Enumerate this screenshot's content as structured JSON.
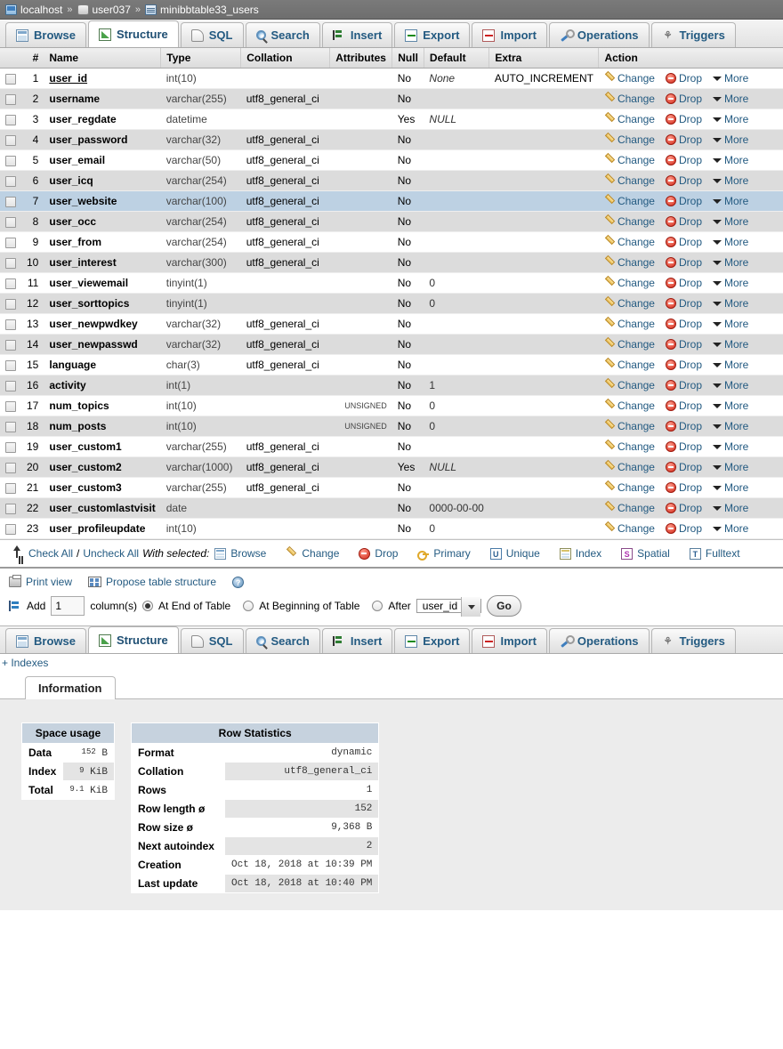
{
  "breadcrumb": {
    "server": "localhost",
    "database": "user037",
    "table": "minibbtable33_users",
    "separator": "»"
  },
  "tabs": [
    {
      "label": "Browse",
      "icon": "browse-icon",
      "active": false
    },
    {
      "label": "Structure",
      "icon": "structure-icon",
      "active": true
    },
    {
      "label": "SQL",
      "icon": "sql-icon",
      "active": false
    },
    {
      "label": "Search",
      "icon": "search-icon",
      "active": false
    },
    {
      "label": "Insert",
      "icon": "insert-icon",
      "active": false
    },
    {
      "label": "Export",
      "icon": "export-icon",
      "active": false
    },
    {
      "label": "Import",
      "icon": "import-icon",
      "active": false
    },
    {
      "label": "Operations",
      "icon": "operations-icon",
      "active": false
    },
    {
      "label": "Triggers",
      "icon": "triggers-icon",
      "active": false
    }
  ],
  "structure": {
    "headers": [
      "#",
      "Name",
      "Type",
      "Collation",
      "Attributes",
      "Null",
      "Default",
      "Extra",
      "Action"
    ],
    "actions": {
      "change": "Change",
      "drop": "Drop",
      "more": "More"
    },
    "rows": [
      {
        "num": 1,
        "name": "user_id",
        "primary": true,
        "type": "int(10)",
        "collation": "",
        "attributes": "",
        "null": "No",
        "default": "None",
        "default_italic": true,
        "extra": "AUTO_INCREMENT",
        "marked": false
      },
      {
        "num": 2,
        "name": "username",
        "primary": false,
        "type": "varchar(255)",
        "collation": "utf8_general_ci",
        "attributes": "",
        "null": "No",
        "default": "",
        "default_italic": false,
        "extra": "",
        "marked": false
      },
      {
        "num": 3,
        "name": "user_regdate",
        "primary": false,
        "type": "datetime",
        "collation": "",
        "attributes": "",
        "null": "Yes",
        "default": "NULL",
        "default_italic": true,
        "extra": "",
        "marked": false
      },
      {
        "num": 4,
        "name": "user_password",
        "primary": false,
        "type": "varchar(32)",
        "collation": "utf8_general_ci",
        "attributes": "",
        "null": "No",
        "default": "",
        "default_italic": false,
        "extra": "",
        "marked": false
      },
      {
        "num": 5,
        "name": "user_email",
        "primary": false,
        "type": "varchar(50)",
        "collation": "utf8_general_ci",
        "attributes": "",
        "null": "No",
        "default": "",
        "default_italic": false,
        "extra": "",
        "marked": false
      },
      {
        "num": 6,
        "name": "user_icq",
        "primary": false,
        "type": "varchar(254)",
        "collation": "utf8_general_ci",
        "attributes": "",
        "null": "No",
        "default": "",
        "default_italic": false,
        "extra": "",
        "marked": false
      },
      {
        "num": 7,
        "name": "user_website",
        "primary": false,
        "type": "varchar(100)",
        "collation": "utf8_general_ci",
        "attributes": "",
        "null": "No",
        "default": "",
        "default_italic": false,
        "extra": "",
        "marked": true
      },
      {
        "num": 8,
        "name": "user_occ",
        "primary": false,
        "type": "varchar(254)",
        "collation": "utf8_general_ci",
        "attributes": "",
        "null": "No",
        "default": "",
        "default_italic": false,
        "extra": "",
        "marked": false
      },
      {
        "num": 9,
        "name": "user_from",
        "primary": false,
        "type": "varchar(254)",
        "collation": "utf8_general_ci",
        "attributes": "",
        "null": "No",
        "default": "",
        "default_italic": false,
        "extra": "",
        "marked": false
      },
      {
        "num": 10,
        "name": "user_interest",
        "primary": false,
        "type": "varchar(300)",
        "collation": "utf8_general_ci",
        "attributes": "",
        "null": "No",
        "default": "",
        "default_italic": false,
        "extra": "",
        "marked": false
      },
      {
        "num": 11,
        "name": "user_viewemail",
        "primary": false,
        "type": "tinyint(1)",
        "collation": "",
        "attributes": "",
        "null": "No",
        "default": "0",
        "default_italic": false,
        "extra": "",
        "marked": false
      },
      {
        "num": 12,
        "name": "user_sorttopics",
        "primary": false,
        "type": "tinyint(1)",
        "collation": "",
        "attributes": "",
        "null": "No",
        "default": "0",
        "default_italic": false,
        "extra": "",
        "marked": false
      },
      {
        "num": 13,
        "name": "user_newpwdkey",
        "primary": false,
        "type": "varchar(32)",
        "collation": "utf8_general_ci",
        "attributes": "",
        "null": "No",
        "default": "",
        "default_italic": false,
        "extra": "",
        "marked": false
      },
      {
        "num": 14,
        "name": "user_newpasswd",
        "primary": false,
        "type": "varchar(32)",
        "collation": "utf8_general_ci",
        "attributes": "",
        "null": "No",
        "default": "",
        "default_italic": false,
        "extra": "",
        "marked": false
      },
      {
        "num": 15,
        "name": "language",
        "primary": false,
        "type": "char(3)",
        "collation": "utf8_general_ci",
        "attributes": "",
        "null": "No",
        "default": "",
        "default_italic": false,
        "extra": "",
        "marked": false
      },
      {
        "num": 16,
        "name": "activity",
        "primary": false,
        "type": "int(1)",
        "collation": "",
        "attributes": "",
        "null": "No",
        "default": "1",
        "default_italic": false,
        "extra": "",
        "marked": false
      },
      {
        "num": 17,
        "name": "num_topics",
        "primary": false,
        "type": "int(10)",
        "collation": "",
        "attributes": "UNSIGNED",
        "null": "No",
        "default": "0",
        "default_italic": false,
        "extra": "",
        "marked": false
      },
      {
        "num": 18,
        "name": "num_posts",
        "primary": false,
        "type": "int(10)",
        "collation": "",
        "attributes": "UNSIGNED",
        "null": "No",
        "default": "0",
        "default_italic": false,
        "extra": "",
        "marked": false
      },
      {
        "num": 19,
        "name": "user_custom1",
        "primary": false,
        "type": "varchar(255)",
        "collation": "utf8_general_ci",
        "attributes": "",
        "null": "No",
        "default": "",
        "default_italic": false,
        "extra": "",
        "marked": false
      },
      {
        "num": 20,
        "name": "user_custom2",
        "primary": false,
        "type": "varchar(1000)",
        "collation": "utf8_general_ci",
        "attributes": "",
        "null": "Yes",
        "default": "NULL",
        "default_italic": true,
        "extra": "",
        "marked": false
      },
      {
        "num": 21,
        "name": "user_custom3",
        "primary": false,
        "type": "varchar(255)",
        "collation": "utf8_general_ci",
        "attributes": "",
        "null": "No",
        "default": "",
        "default_italic": false,
        "extra": "",
        "marked": false
      },
      {
        "num": 22,
        "name": "user_customlastvisit",
        "primary": false,
        "type": "date",
        "collation": "",
        "attributes": "",
        "null": "No",
        "default": "0000-00-00",
        "default_italic": false,
        "extra": "",
        "marked": false
      },
      {
        "num": 23,
        "name": "user_profileupdate",
        "primary": false,
        "type": "int(10)",
        "collation": "",
        "attributes": "",
        "null": "No",
        "default": "0",
        "default_italic": false,
        "extra": "",
        "marked": false
      }
    ]
  },
  "with_selected": {
    "check_all": "Check All",
    "slash": "/",
    "uncheck_all": "Uncheck All",
    "label": "With selected:",
    "items": [
      {
        "label": "Browse",
        "icon": "browse-icon"
      },
      {
        "label": "Change",
        "icon": "pencil-icon"
      },
      {
        "label": "Drop",
        "icon": "drop-icon"
      },
      {
        "label": "Primary",
        "icon": "key-icon"
      },
      {
        "label": "Unique",
        "icon": "unique-icon"
      },
      {
        "label": "Index",
        "icon": "index-icon"
      },
      {
        "label": "Spatial",
        "icon": "spatial-icon"
      },
      {
        "label": "Fulltext",
        "icon": "fulltext-icon"
      }
    ]
  },
  "print_row": {
    "print_view": "Print view",
    "propose": "Propose table structure",
    "help": "?"
  },
  "add_form": {
    "add_label": "Add",
    "count_value": "1",
    "columns_label": "column(s)",
    "at_end": "At End of Table",
    "at_beginning": "At Beginning of Table",
    "after": "After",
    "after_column": "user_id",
    "go": "Go",
    "selected_position": "at_end"
  },
  "indexes_link": "+ Indexes",
  "info_panel": {
    "tab_label": "Information",
    "space_usage": {
      "title": "Space usage",
      "rows": [
        {
          "label": "Data",
          "number": "152",
          "unit": "B"
        },
        {
          "label": "Index",
          "number": "9",
          "unit": "KiB"
        },
        {
          "label": "Total",
          "number": "9.1",
          "unit": "KiB"
        }
      ]
    },
    "row_statistics": {
      "title": "Row Statistics",
      "rows": [
        {
          "label": "Format",
          "value": "dynamic"
        },
        {
          "label": "Collation",
          "value": "utf8_general_ci"
        },
        {
          "label": "Rows",
          "value": "1"
        },
        {
          "label": "Row length ø",
          "value": "152"
        },
        {
          "label": "Row size ø",
          "value": "9,368 B"
        },
        {
          "label": "Next autoindex",
          "value": "2"
        },
        {
          "label": "Creation",
          "value": "Oct 18, 2018 at 10:39 PM"
        },
        {
          "label": "Last update",
          "value": "Oct 18, 2018 at 10:40 PM"
        }
      ]
    }
  },
  "colors": {
    "link": "#235a81",
    "breadcrumb_bg": "#6e6e6e",
    "row_even": "#dcdcdc",
    "row_marked": "#bdd1e3",
    "stats_header": "#c6d2de"
  }
}
